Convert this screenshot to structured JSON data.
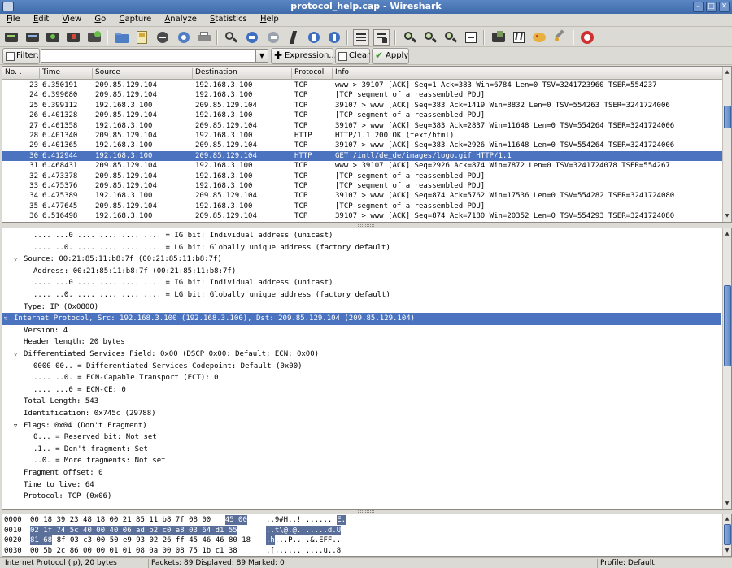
{
  "window": {
    "title": "protocol_help.cap - Wireshark"
  },
  "menu": [
    "File",
    "Edit",
    "View",
    "Go",
    "Capture",
    "Analyze",
    "Statistics",
    "Help"
  ],
  "filter": {
    "label": "Filter:",
    "value": "",
    "expression_label": "Expression...",
    "clear_label": "Clear",
    "apply_label": "Apply"
  },
  "packet_list": {
    "columns": [
      "No. .",
      "Time",
      "Source",
      "Destination",
      "Protocol",
      "Info"
    ],
    "rows": [
      {
        "no": "23",
        "time": "6.350191",
        "src": "209.85.129.104",
        "dst": "192.168.3.100",
        "proto": "TCP",
        "info": "www > 39107 [ACK] Seq=1 Ack=383 Win=6784 Len=0 TSV=3241723960 TSER=554237"
      },
      {
        "no": "24",
        "time": "6.399080",
        "src": "209.85.129.104",
        "dst": "192.168.3.100",
        "proto": "TCP",
        "info": "[TCP segment of a reassembled PDU]"
      },
      {
        "no": "25",
        "time": "6.399112",
        "src": "192.168.3.100",
        "dst": "209.85.129.104",
        "proto": "TCP",
        "info": "39107 > www [ACK] Seq=383 Ack=1419 Win=8832 Len=0 TSV=554263 TSER=3241724006"
      },
      {
        "no": "26",
        "time": "6.401328",
        "src": "209.85.129.104",
        "dst": "192.168.3.100",
        "proto": "TCP",
        "info": "[TCP segment of a reassembled PDU]"
      },
      {
        "no": "27",
        "time": "6.401358",
        "src": "192.168.3.100",
        "dst": "209.85.129.104",
        "proto": "TCP",
        "info": "39107 > www [ACK] Seq=383 Ack=2837 Win=11648 Len=0 TSV=554264 TSER=3241724006"
      },
      {
        "no": "28",
        "time": "6.401340",
        "src": "209.85.129.104",
        "dst": "192.168.3.100",
        "proto": "HTTP",
        "info": "HTTP/1.1 200 OK  (text/html)"
      },
      {
        "no": "29",
        "time": "6.401365",
        "src": "192.168.3.100",
        "dst": "209.85.129.104",
        "proto": "TCP",
        "info": "39107 > www [ACK] Seq=383 Ack=2926 Win=11648 Len=0 TSV=554264 TSER=3241724006"
      },
      {
        "no": "30",
        "time": "6.412944",
        "src": "192.168.3.100",
        "dst": "209.85.129.104",
        "proto": "HTTP",
        "info": "GET /intl/de_de/images/logo.gif HTTP/1.1",
        "selected": true
      },
      {
        "no": "31",
        "time": "6.468431",
        "src": "209.85.129.104",
        "dst": "192.168.3.100",
        "proto": "TCP",
        "info": "www > 39107 [ACK] Seq=2926 Ack=874 Win=7872 Len=0 TSV=3241724078 TSER=554267"
      },
      {
        "no": "32",
        "time": "6.473378",
        "src": "209.85.129.104",
        "dst": "192.168.3.100",
        "proto": "TCP",
        "info": "[TCP segment of a reassembled PDU]"
      },
      {
        "no": "33",
        "time": "6.475376",
        "src": "209.85.129.104",
        "dst": "192.168.3.100",
        "proto": "TCP",
        "info": "[TCP segment of a reassembled PDU]"
      },
      {
        "no": "34",
        "time": "6.475389",
        "src": "192.168.3.100",
        "dst": "209.85.129.104",
        "proto": "TCP",
        "info": "39107 > www [ACK] Seq=874 Ack=5762 Win=17536 Len=0 TSV=554282 TSER=3241724080"
      },
      {
        "no": "35",
        "time": "6.477645",
        "src": "209.85.129.104",
        "dst": "192.168.3.100",
        "proto": "TCP",
        "info": "[TCP segment of a reassembled PDU]"
      },
      {
        "no": "36",
        "time": "6.516498",
        "src": "192.168.3.100",
        "dst": "209.85.129.104",
        "proto": "TCP",
        "info": "39107 > www [ACK] Seq=874 Ack=7180 Win=20352 Len=0 TSV=554293 TSER=3241724080"
      }
    ]
  },
  "details": [
    {
      "text": ".... ...0 .... .... .... .... = IG bit: Individual address (unicast)",
      "indent": 2,
      "exp": ""
    },
    {
      "text": ".... ..0. .... .... .... .... = LG bit: Globally unique address (factory default)",
      "indent": 2,
      "exp": ""
    },
    {
      "text": "Source: 00:21:85:11:b8:7f (00:21:85:11:b8:7f)",
      "indent": 1,
      "exp": "▽"
    },
    {
      "text": "Address: 00:21:85:11:b8:7f (00:21:85:11:b8:7f)",
      "indent": 2,
      "exp": ""
    },
    {
      "text": ".... ...0 .... .... .... .... = IG bit: Individual address (unicast)",
      "indent": 2,
      "exp": ""
    },
    {
      "text": ".... ..0. .... .... .... .... = LG bit: Globally unique address (factory default)",
      "indent": 2,
      "exp": ""
    },
    {
      "text": "Type: IP (0x0800)",
      "indent": 1,
      "exp": ""
    },
    {
      "text": "Internet Protocol, Src: 192.168.3.100 (192.168.3.100), Dst: 209.85.129.104 (209.85.129.104)",
      "indent": 0,
      "exp": "▽",
      "selected": true
    },
    {
      "text": "Version: 4",
      "indent": 1,
      "exp": ""
    },
    {
      "text": "Header length: 20 bytes",
      "indent": 1,
      "exp": ""
    },
    {
      "text": "Differentiated Services Field: 0x00 (DSCP 0x00: Default; ECN: 0x00)",
      "indent": 1,
      "exp": "▽"
    },
    {
      "text": "0000 00.. = Differentiated Services Codepoint: Default (0x00)",
      "indent": 2,
      "exp": ""
    },
    {
      "text": ".... ..0. = ECN-Capable Transport (ECT): 0",
      "indent": 2,
      "exp": ""
    },
    {
      "text": ".... ...0 = ECN-CE: 0",
      "indent": 2,
      "exp": ""
    },
    {
      "text": "Total Length: 543",
      "indent": 1,
      "exp": ""
    },
    {
      "text": "Identification: 0x745c (29788)",
      "indent": 1,
      "exp": ""
    },
    {
      "text": "Flags: 0x04 (Don't Fragment)",
      "indent": 1,
      "exp": "▽"
    },
    {
      "text": "0... = Reserved bit: Not set",
      "indent": 2,
      "exp": ""
    },
    {
      "text": ".1.. = Don't fragment: Set",
      "indent": 2,
      "exp": ""
    },
    {
      "text": "..0. = More fragments: Not set",
      "indent": 2,
      "exp": ""
    },
    {
      "text": "Fragment offset: 0",
      "indent": 1,
      "exp": ""
    },
    {
      "text": "Time to live: 64",
      "indent": 1,
      "exp": ""
    },
    {
      "text": "Protocol: TCP (0x06)",
      "indent": 1,
      "exp": ""
    }
  ],
  "hex": [
    {
      "off": "0000",
      "bytes_plain": "00 18 39 23 48 18 00 21  85 11 b8 7f 08 00",
      "bytes_hl": "45 00",
      "ascii_plain": "..9#H..! ......",
      "ascii_hl": "E."
    },
    {
      "off": "0010",
      "bytes_plain": "",
      "bytes_hl": "02 1f 74 5c 40 00 40 06  ad b2 c0 a8 03 64 d1 55",
      "ascii_plain": "",
      "ascii_hl": "..t\\@.@. .....d.U"
    },
    {
      "off": "0020",
      "bytes_plain": "8f 03 c3 00 50 e9 93  02 26 ff 45 46 46 80 18",
      "bytes_hl": "81 68",
      "ascii_plain": "...P.. .&.EFF..",
      "ascii_hl": ".h"
    },
    {
      "off": "0030",
      "bytes_plain": "00 5b 2c 86 00 00 01 01  08 0a 00 08 75 1b c1 38",
      "bytes_hl": "",
      "ascii_plain": ".[,..... ....u..8",
      "ascii_hl": ""
    }
  ],
  "status": {
    "left": "Internet Protocol (ip), 20 bytes",
    "middle": "Packets: 89 Displayed: 89 Marked: 0",
    "right": "Profile: Default"
  }
}
